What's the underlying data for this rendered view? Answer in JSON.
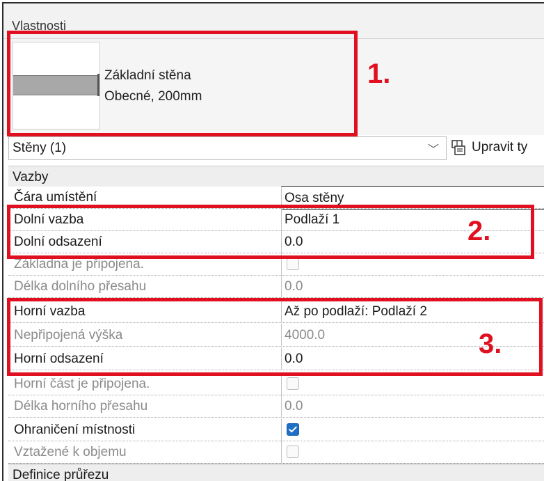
{
  "panel": {
    "title": "Vlastnosti"
  },
  "type_selector": {
    "name": "Základní stěna",
    "subtype": "Obecné, 200mm"
  },
  "filter": {
    "value": "Stěny (1)",
    "edit_type_label": "Upravit ty"
  },
  "sections": {
    "constraints": "Vazby",
    "cross_section": "Definice průřezu"
  },
  "properties": [
    {
      "name": "Čára umístění",
      "value": "Osa stěny"
    },
    {
      "name": "Dolní vazba",
      "value": "Podlaží 1"
    },
    {
      "name": "Dolní odsazení",
      "value": "0.0"
    },
    {
      "name": "Základna je připojena.",
      "checked": false
    },
    {
      "name": "Délka dolního přesahu",
      "value": "0.0"
    },
    {
      "name": "Horní vazba",
      "value": "Až po podlaží: Podlaží 2"
    },
    {
      "name": "Nepřipojená výška",
      "value": "4000.0"
    },
    {
      "name": "Horní odsazení",
      "value": "0.0"
    },
    {
      "name": "Horní část je připojena.",
      "checked": false
    },
    {
      "name": "Délka horního přesahu",
      "value": "0.0"
    },
    {
      "name": "Ohraničení místnosti",
      "checked": true
    },
    {
      "name": "Vztažené k objemu",
      "checked": false
    }
  ],
  "annotations": {
    "a1": "1.",
    "a2": "2.",
    "a3": "3."
  },
  "colors": {
    "annotation": "#e01020",
    "checkbox_checked": "#1f6fc6"
  },
  "icons": {
    "dropdown": "chevron-down-icon",
    "edit_type": "edit-type-icon"
  }
}
